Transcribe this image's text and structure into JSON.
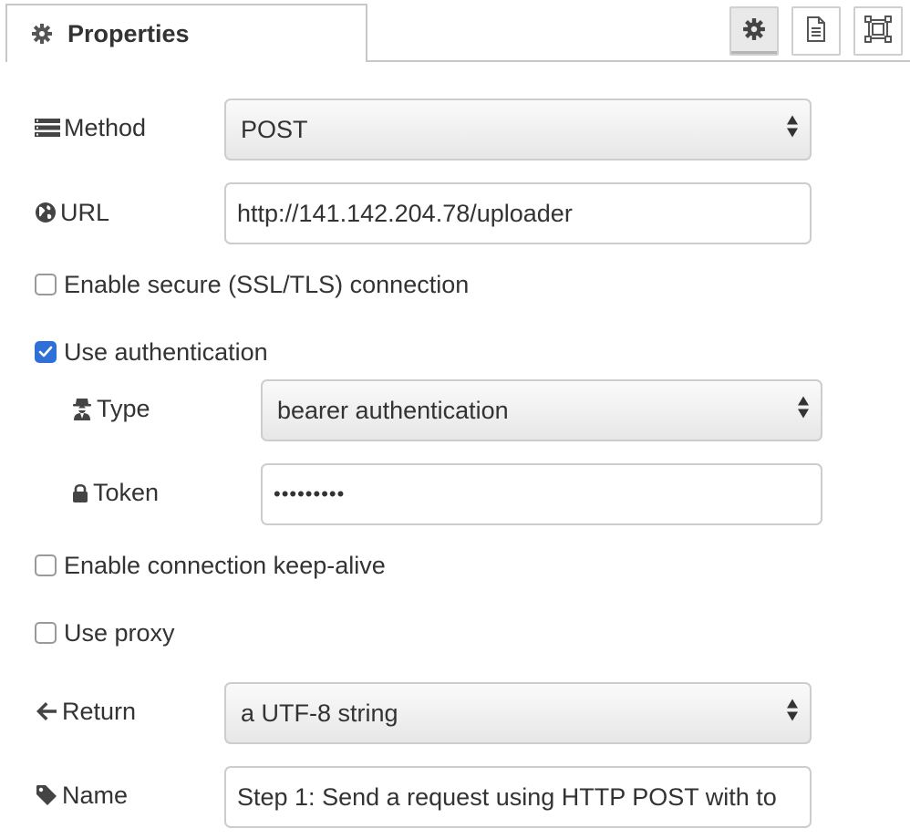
{
  "tab": {
    "label": "Properties",
    "icon": "gear-icon"
  },
  "toolbar": {
    "buttons": [
      {
        "name": "settings",
        "icon": "gear-icon",
        "selected": true
      },
      {
        "name": "description",
        "icon": "document-icon",
        "selected": false
      },
      {
        "name": "appearance",
        "icon": "frame-icon",
        "selected": false
      }
    ]
  },
  "form": {
    "method": {
      "label": "Method",
      "icon": "list-icon",
      "value": "POST"
    },
    "url": {
      "label": "URL",
      "icon": "globe-icon",
      "value": "http://141.142.204.78/uploader"
    },
    "ssl": {
      "label": "Enable secure (SSL/TLS) connection",
      "checked": false
    },
    "auth": {
      "label": "Use authentication",
      "checked": true
    },
    "auth_type": {
      "label": "Type",
      "icon": "user-secret-icon",
      "value": "bearer authentication"
    },
    "token": {
      "label": "Token",
      "icon": "lock-icon",
      "value": "•••••••••"
    },
    "keepalive": {
      "label": "Enable connection keep-alive",
      "checked": false
    },
    "proxy": {
      "label": "Use proxy",
      "checked": false
    },
    "return": {
      "label": "Return",
      "icon": "arrow-left-icon",
      "value": "a UTF-8 string"
    },
    "name": {
      "label": "Name",
      "icon": "tag-icon",
      "value": "Step 1: Send a request using HTTP POST with to"
    }
  },
  "colors": {
    "accent": "#2f6fd8",
    "border": "#c8c8c8",
    "text": "#333333"
  }
}
